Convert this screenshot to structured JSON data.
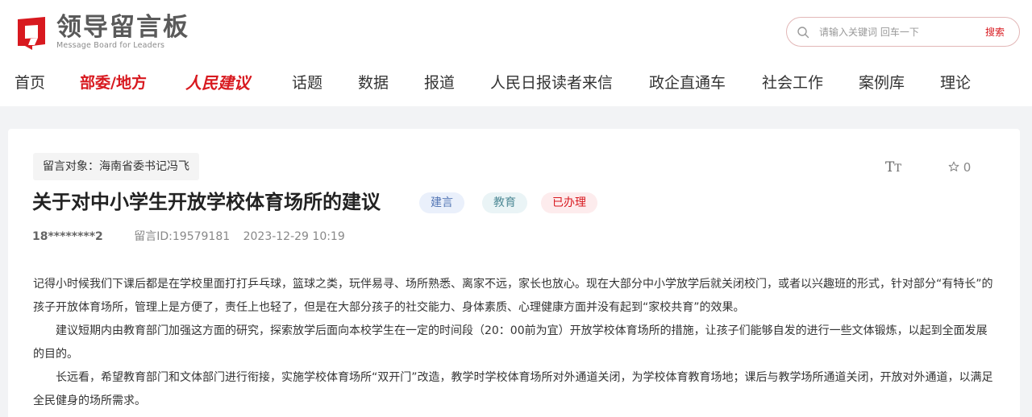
{
  "site": {
    "title": "领导留言板",
    "subtitle": "Message Board for Leaders"
  },
  "search": {
    "placeholder": "请输入关键词 回车一下",
    "button_label": "搜索"
  },
  "nav": {
    "items": [
      {
        "label": "首页",
        "active": false
      },
      {
        "label": "部委/地方",
        "active": true
      },
      {
        "label": "人民建议",
        "active": false
      },
      {
        "label": "话题",
        "active": false
      },
      {
        "label": "数据",
        "active": false
      },
      {
        "label": "报道",
        "active": false
      },
      {
        "label": "人民日报读者来信",
        "active": false
      },
      {
        "label": "政企直通车",
        "active": false
      },
      {
        "label": "社会工作",
        "active": false
      },
      {
        "label": "案例库",
        "active": false
      },
      {
        "label": "理论",
        "active": false
      }
    ]
  },
  "message": {
    "target": "留言对象：海南省委书记冯飞",
    "title": "关于对中小学生开放学校体育场所的建议",
    "tags": [
      "建言",
      "教育",
      "已办理"
    ],
    "user": "18********2",
    "id": "留言ID:19579181",
    "time": "2023-12-29 10:19",
    "favorite_count": "0",
    "paragraphs": [
      "记得小时候我们下课后都是在学校里面打打乒乓球，篮球之类，玩伴易寻、场所熟悉、离家不远，家长也放心。现在大部分中小学放学后就关闭校门，或者以兴趣班的形式，针对部分“有特长”的孩子开放体育场所，管理上是方便了，责任上也轻了，但是在大部分孩子的社交能力、身体素质、心理健康方面并没有起到“家校共育”的效果。",
      "建议短期内由教育部门加强这方面的研究，探索放学后面向本校学生在一定的时间段（20：00前为宜）开放学校体育场所的措施，让孩子们能够自发的进行一些文体锻炼，以起到全面发展的目的。",
      "长远看，希望教育部门和文体部门进行衔接，实施学校体育场所“双开门”改造，教学时学校体育场所对外通道关闭，为学校体育教育场地；课后与教学场所通道关闭，开放对外通道，以满足全民健身的场所需求。"
    ]
  },
  "colors": {
    "brand_red": "#d8191f",
    "logo_gray": "#5a5a5a",
    "tag_blue_bg": "#eaf0fb",
    "tag_teal_bg": "#eaf4f6",
    "tag_red_bg": "#fdeced"
  },
  "icons": {
    "logo": "logo-mark-icon",
    "search": "search-icon",
    "font_size": "font-size-icon",
    "favorite": "star-icon"
  }
}
